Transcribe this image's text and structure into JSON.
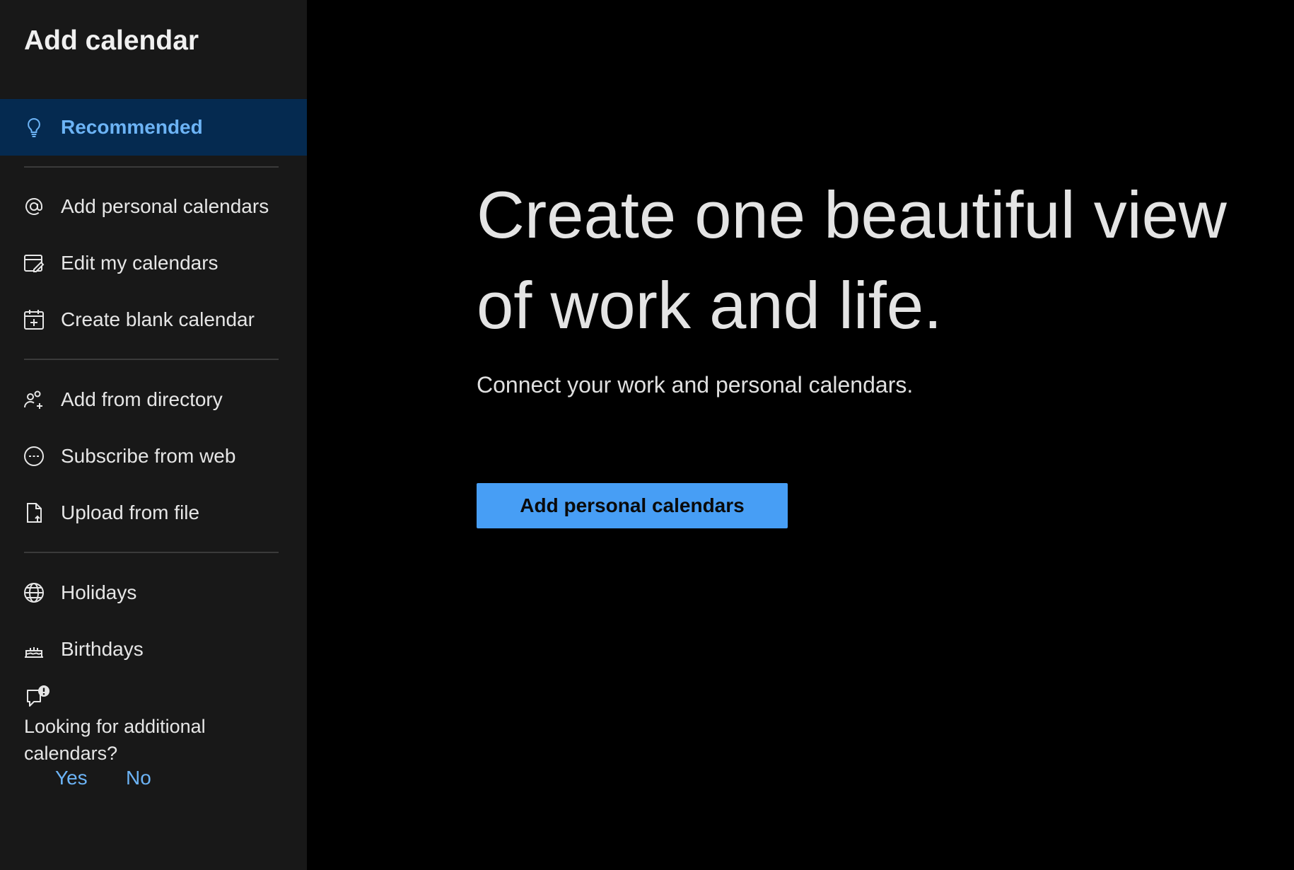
{
  "sidebar": {
    "title": "Add calendar",
    "items": [
      {
        "label": "Recommended",
        "icon": "lightbulb-icon",
        "active": true
      },
      {
        "label": "Add personal calendars",
        "icon": "at-sign-icon"
      },
      {
        "label": "Edit my calendars",
        "icon": "edit-calendar-icon"
      },
      {
        "label": "Create blank calendar",
        "icon": "calendar-add-icon"
      },
      {
        "label": "Add from directory",
        "icon": "people-add-icon"
      },
      {
        "label": "Subscribe from web",
        "icon": "link-circle-icon"
      },
      {
        "label": "Upload from file",
        "icon": "file-upload-icon"
      },
      {
        "label": "Holidays",
        "icon": "globe-icon"
      },
      {
        "label": "Birthdays",
        "icon": "cake-icon"
      }
    ],
    "feedback": {
      "icon": "feedback-alert-icon",
      "question": "Looking for additional calendars?",
      "yes_label": "Yes",
      "no_label": "No"
    }
  },
  "main": {
    "title": "Create one beautiful view of work and life.",
    "subtitle": "Connect your work and personal calendars.",
    "button_label": "Add personal calendars"
  },
  "colors": {
    "sidebar_bg": "#181818",
    "main_bg": "#000000",
    "active_item_bg": "#052a50",
    "accent": "#6cb3f5",
    "primary_button": "#479ef5"
  }
}
